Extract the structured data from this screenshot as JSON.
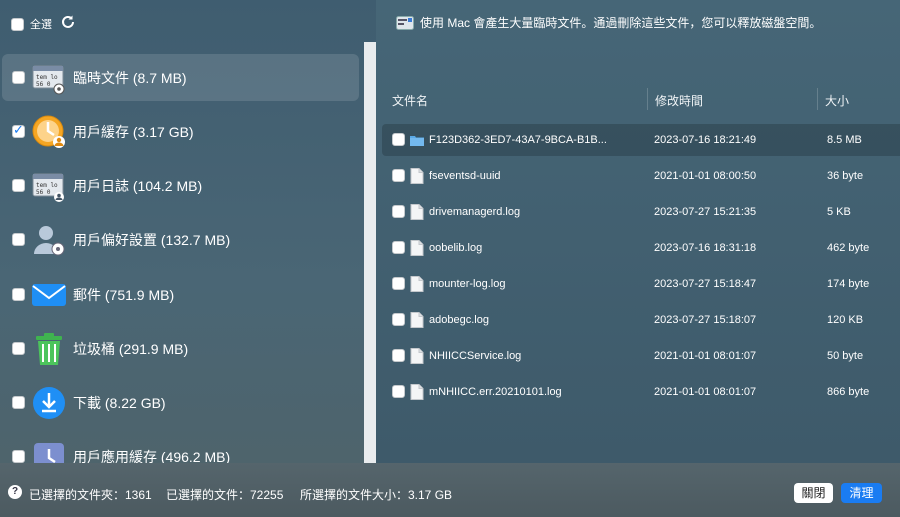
{
  "toolbar": {
    "select_all_label": "全選"
  },
  "categories": [
    {
      "label": "臨時文件 (8.7 MB)",
      "icon": "log-file-gear-icon",
      "checked": false,
      "selected": true
    },
    {
      "label": "用戶緩存 (3.17 GB)",
      "icon": "clock-user-icon",
      "checked": true,
      "selected": false
    },
    {
      "label": "用戶日誌 (104.2 MB)",
      "icon": "log-file-user-icon",
      "checked": false,
      "selected": false
    },
    {
      "label": "用戶偏好設置 (132.7 MB)",
      "icon": "user-gear-icon",
      "checked": false,
      "selected": false
    },
    {
      "label": "郵件 (751.9 MB)",
      "icon": "mail-icon",
      "checked": false,
      "selected": false
    },
    {
      "label": "垃圾桶 (291.9 MB)",
      "icon": "trash-icon",
      "checked": false,
      "selected": false
    },
    {
      "label": "下載 (8.22 GB)",
      "icon": "download-icon",
      "checked": false,
      "selected": false
    },
    {
      "label": "用戶應用緩存 (496.2 MB)",
      "icon": "app-cache-icon",
      "checked": false,
      "selected": false
    }
  ],
  "detail": {
    "note": "使用 Mac 會產生大量臨時文件。通過刪除這些文件，您可以釋放磁盤空間。",
    "columns": {
      "name": "文件名",
      "time": "修改時間",
      "size": "大小"
    },
    "files": [
      {
        "name": "F123D362-3ED7-43A7-9BCA-B1B...",
        "time": "2023-07-16 18:21:49",
        "size": "8.5 MB",
        "icon": "folder-icon",
        "selected": true
      },
      {
        "name": "fseventsd-uuid",
        "time": "2021-01-01 08:00:50",
        "size": "36 byte",
        "icon": "file-icon",
        "selected": false
      },
      {
        "name": "drivemanagerd.log",
        "time": "2023-07-27 15:21:35",
        "size": "5 KB",
        "icon": "file-icon",
        "selected": false
      },
      {
        "name": "oobelib.log",
        "time": "2023-07-16 18:31:18",
        "size": "462 byte",
        "icon": "file-icon",
        "selected": false
      },
      {
        "name": "mounter-log.log",
        "time": "2023-07-27 15:18:47",
        "size": "174 byte",
        "icon": "file-icon",
        "selected": false
      },
      {
        "name": "adobegc.log",
        "time": "2023-07-27 15:18:07",
        "size": "120 KB",
        "icon": "file-icon",
        "selected": false
      },
      {
        "name": "NHIICCService.log",
        "time": "2021-01-01 08:01:07",
        "size": "50 byte",
        "icon": "file-icon",
        "selected": false
      },
      {
        "name": "mNHIICC.err.20210101.log",
        "time": "2021-01-01 08:01:07",
        "size": "866 byte",
        "icon": "file-icon",
        "selected": false
      }
    ]
  },
  "status": {
    "help": "?",
    "folders_selected": "已選擇的文件夾：1361",
    "files_selected": "已選擇的文件：72255",
    "total_size": "所選擇的文件大小：3.17 GB",
    "close_label": "關閉",
    "clean_label": "清理"
  },
  "colors": {
    "accent": "#1a7cf2"
  }
}
